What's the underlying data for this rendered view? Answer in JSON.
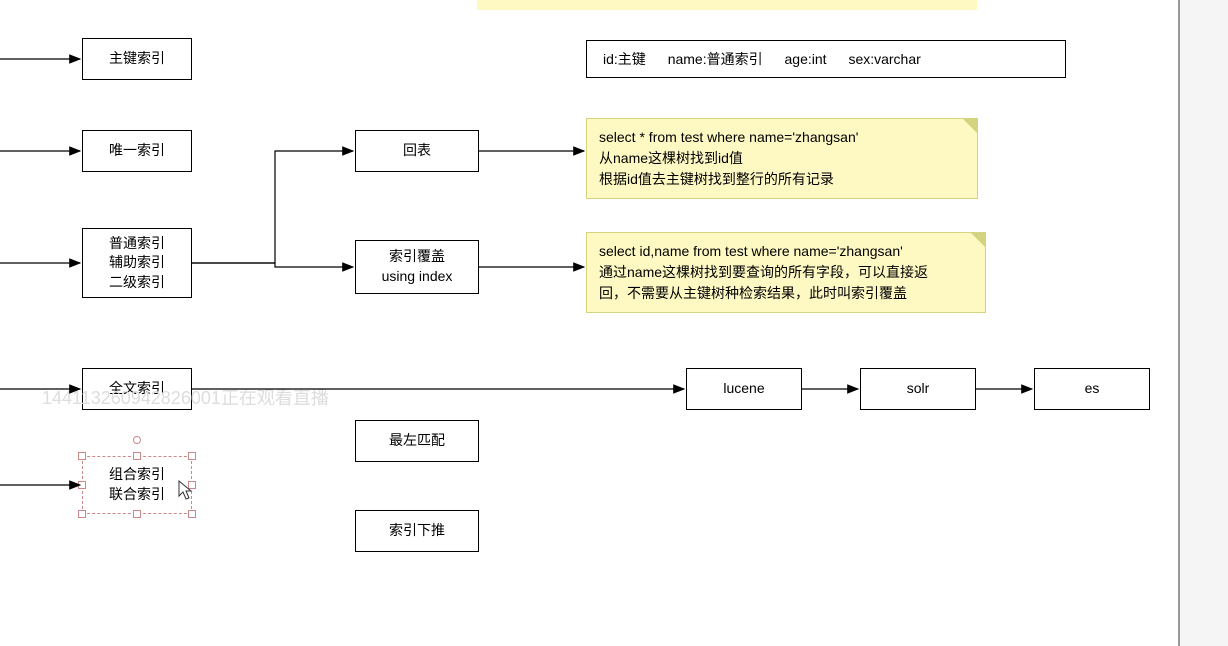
{
  "boxes": {
    "primary_index": "主键索引",
    "unique_index": "唯一索引",
    "secondary_index": "普通索引\n辅助索引\n二级索引",
    "fulltext_index": "全文索引",
    "composite_index": "组合索引\n联合索引",
    "back_to_table": "回表",
    "index_covering": "索引覆盖\nusing index",
    "leftmost_match": "最左匹配",
    "index_pushdown": "索引下推",
    "lucene": "lucene",
    "solr": "solr",
    "es": "es"
  },
  "schema": {
    "id": "id:主键",
    "name": "name:普通索引",
    "age": "age:int",
    "sex": "sex:varchar"
  },
  "notes": {
    "note1_line1": "select * from test where name='zhangsan'",
    "note1_line2": "从name这棵树找到id值",
    "note1_line3": "根据id值去主键树找到整行的所有记录",
    "note2_line1": "select id,name  from test where name='zhangsan'",
    "note2_line2": "通过name这棵树找到要查询的所有字段，可以直接返",
    "note2_line3": "回，不需要从主键树种检索结果，此时叫索引覆盖"
  },
  "watermark": "144113260942826001正在观看直播"
}
